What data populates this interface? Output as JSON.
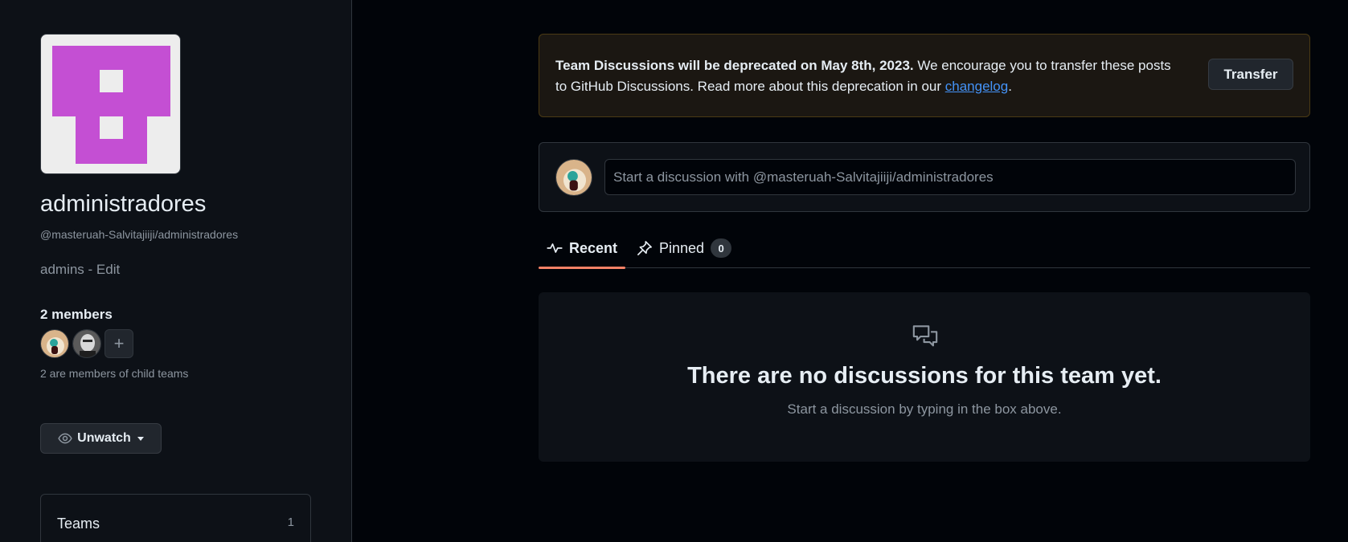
{
  "team": {
    "name": "administradores",
    "slug": "@masteruah-Salvitajiiji/administradores",
    "description": "admins",
    "separator": " - ",
    "edit_label": "Edit",
    "avatar_color": "#c44fd3",
    "avatar_bg": "#ededed"
  },
  "members": {
    "count_label": "2 members",
    "child_note": "2 are members of child teams",
    "add_icon": "plus-icon"
  },
  "watch": {
    "label": "Unwatch",
    "icon": "eye-icon"
  },
  "teams_box": {
    "label": "Teams",
    "count": "1"
  },
  "banner": {
    "bold_text": "Team Discussions will be deprecated on May 8th, 2023.",
    "text": " We encourage you to transfer these posts to GitHub Discussions. Read more about this deprecation in our ",
    "link_text": "changelog",
    "end_text": ".",
    "button_label": "Transfer"
  },
  "compose": {
    "placeholder": "Start a discussion with @masteruah-Salvitajiiji/administradores"
  },
  "tabs": [
    {
      "label": "Recent",
      "icon": "pulse-icon",
      "selected": true
    },
    {
      "label": "Pinned",
      "icon": "pin-icon",
      "count": "0"
    }
  ],
  "blank_slate": {
    "icon": "comment-discussion-icon",
    "title": "There are no discussions for this team yet.",
    "subtitle": "Start a discussion by typing in the box above."
  },
  "colors": {
    "background": "#010409",
    "sidebar": "#0d1117",
    "border": "#30363d",
    "accent_underline": "#f78166",
    "link": "#4493f8",
    "banner_bg": "#1b1712",
    "banner_border": "#4b3a14"
  }
}
